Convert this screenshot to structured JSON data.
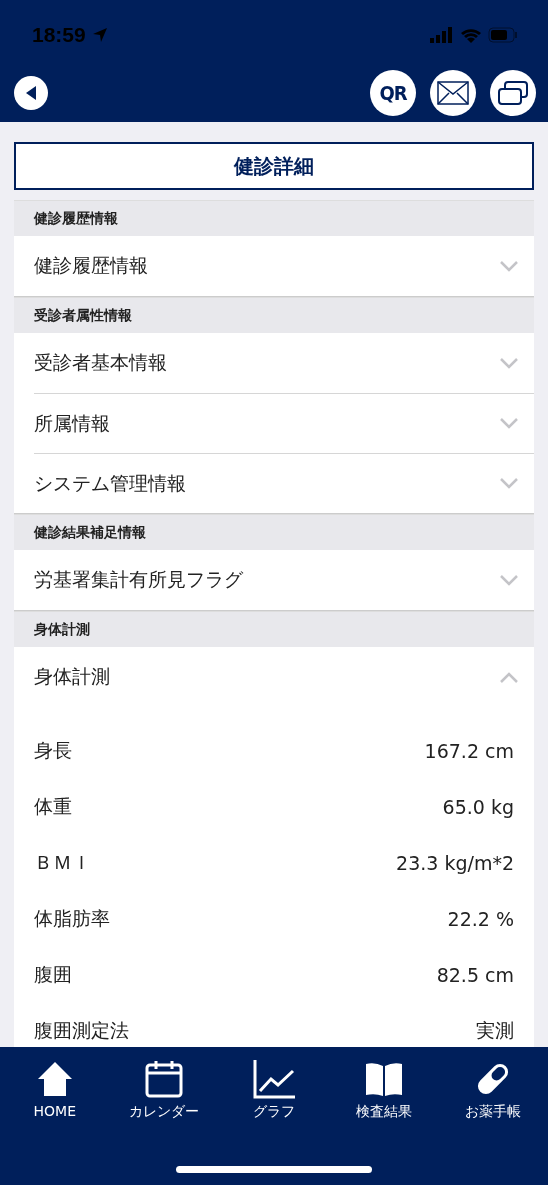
{
  "status_bar": {
    "time": "18:59"
  },
  "header": {
    "qr_label": "QR"
  },
  "page_title": "健診詳細",
  "sections": [
    {
      "title": "健診履歴情報",
      "items": [
        {
          "label": "健診履歴情報",
          "expanded": false
        }
      ]
    },
    {
      "title": "受診者属性情報",
      "items": [
        {
          "label": "受診者基本情報",
          "expanded": false
        },
        {
          "label": "所属情報",
          "expanded": false
        },
        {
          "label": "システム管理情報",
          "expanded": false
        }
      ]
    },
    {
      "title": "健診結果補足情報",
      "items": [
        {
          "label": "労基署集計有所見フラグ",
          "expanded": false
        }
      ]
    },
    {
      "title": "身体計測",
      "items": [
        {
          "label": "身体計測",
          "expanded": true,
          "rows": [
            {
              "label": "身長",
              "value": "167.2 cm"
            },
            {
              "label": "体重",
              "value": "65.0 kg"
            },
            {
              "label": "ＢＭＩ",
              "value": "23.3 kg/m*2"
            },
            {
              "label": "体脂肪率",
              "value": "22.2 %"
            },
            {
              "label": "腹囲",
              "value": "82.5 cm"
            },
            {
              "label": "腹囲測定法",
              "value": "実測"
            }
          ]
        }
      ]
    }
  ],
  "tab_bar": [
    {
      "label": "HOME"
    },
    {
      "label": "カレンダー"
    },
    {
      "label": "グラフ"
    },
    {
      "label": "検査結果"
    },
    {
      "label": "お薬手帳"
    }
  ]
}
